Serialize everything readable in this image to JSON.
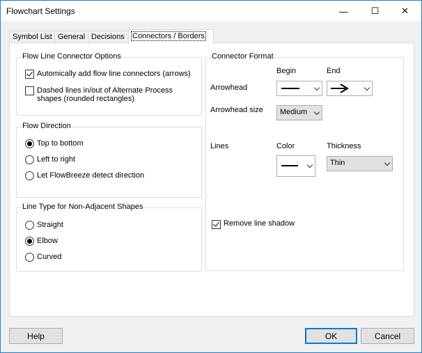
{
  "window": {
    "title": "Flowchart Settings",
    "minimize_glyph": "—",
    "maximize_glyph": "☐",
    "close_glyph": "✕"
  },
  "tabs": [
    {
      "label": "Symbol List",
      "active": false
    },
    {
      "label": "General",
      "active": false
    },
    {
      "label": "Decisions",
      "active": false
    },
    {
      "label": "Connectors / Borders",
      "active": true
    }
  ],
  "flow_line_connector_options": {
    "title": "Flow Line Connector Options",
    "auto_add_label": "Automically add flow line connectors (arrows)",
    "auto_add_checked": true,
    "dashed_label_1": "Dashed lines in/out of Alternate Process",
    "dashed_label_2": "shapes (rounded rectangles)",
    "dashed_checked": false
  },
  "flow_direction": {
    "title": "Flow Direction",
    "options": [
      {
        "label": "Top to bottom",
        "selected": true
      },
      {
        "label": "Left to right",
        "selected": false
      },
      {
        "label": "Let FlowBreeze detect direction",
        "selected": false
      }
    ]
  },
  "line_type": {
    "title": "Line Type for Non-Adjacent Shapes",
    "options": [
      {
        "label": "Straight",
        "selected": false
      },
      {
        "label": "Elbow",
        "selected": true
      },
      {
        "label": "Curved",
        "selected": false
      }
    ]
  },
  "connector_format": {
    "title": "Connector Format",
    "begin_label": "Begin",
    "end_label": "End",
    "arrowhead_label": "Arrowhead",
    "arrowhead_size_label": "Arrowhead size",
    "arrowhead_size_value": "Medium",
    "lines_label": "Lines",
    "color_label": "Color",
    "thickness_label": "Thickness",
    "thickness_value": "Thin",
    "remove_shadow_label": "Remove line shadow",
    "remove_shadow_checked": true
  },
  "footer": {
    "help_label": "Help",
    "ok_label": "OK",
    "cancel_label": "Cancel"
  }
}
